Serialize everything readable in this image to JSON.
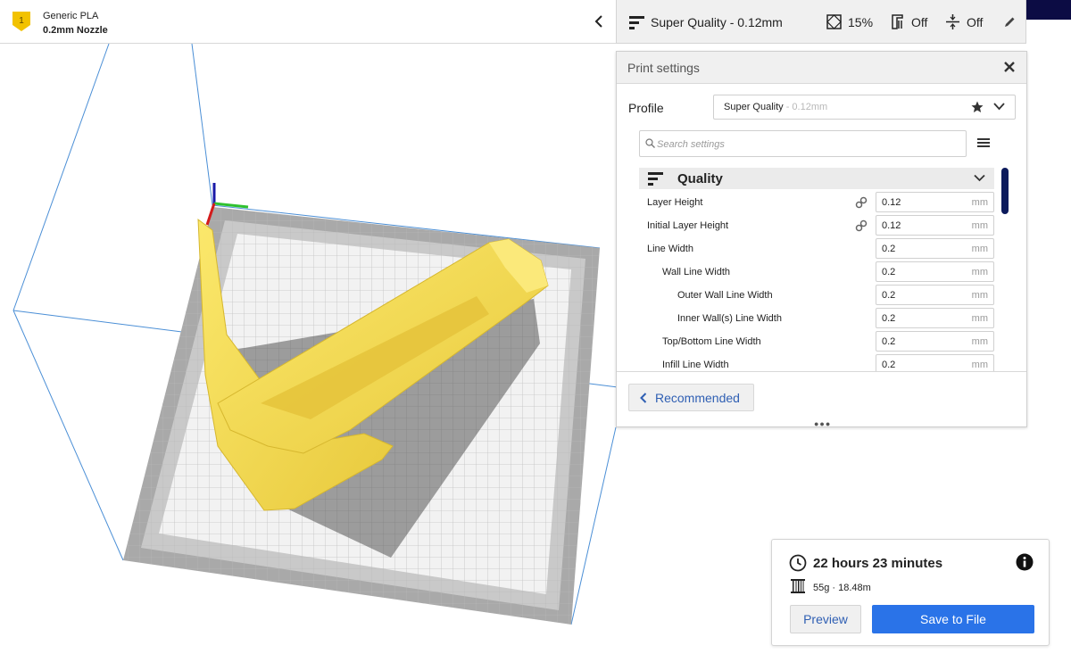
{
  "extruder": {
    "number": "1",
    "material": "Generic PLA",
    "nozzle": "0.2mm Nozzle"
  },
  "settings_bar": {
    "profile": "Super Quality - 0.12mm",
    "infill": "15%",
    "support": "Off",
    "adhesion": "Off"
  },
  "print_settings": {
    "title": "Print settings",
    "profile_label": "Profile",
    "profile_name": "Super Quality",
    "profile_sub": " - 0.12mm",
    "search_placeholder": "Search settings",
    "category": "Quality",
    "rows": [
      {
        "label": "Layer Height",
        "value": "0.12",
        "unit": "mm",
        "linked": true
      },
      {
        "label": "Initial Layer Height",
        "value": "0.12",
        "unit": "mm",
        "linked": true
      },
      {
        "label": "Line Width",
        "value": "0.2",
        "unit": "mm",
        "linked": false
      },
      {
        "label": "Wall Line Width",
        "value": "0.2",
        "unit": "mm",
        "linked": false
      },
      {
        "label": "Outer Wall Line Width",
        "value": "0.2",
        "unit": "mm",
        "linked": false
      },
      {
        "label": "Inner Wall(s) Line Width",
        "value": "0.2",
        "unit": "mm",
        "linked": false
      },
      {
        "label": "Top/Bottom Line Width",
        "value": "0.2",
        "unit": "mm",
        "linked": false
      },
      {
        "label": "Infill Line Width",
        "value": "0.2",
        "unit": "mm",
        "linked": false
      }
    ],
    "recommended_label": "Recommended"
  },
  "estimate": {
    "time": "22 hours 23 minutes",
    "material": "55g · 18.48m",
    "preview_label": "Preview",
    "save_label": "Save to File"
  },
  "colors": {
    "accent": "#2a73e8",
    "link": "#2f5fb3",
    "model": "#f7e15a",
    "dark_strip": "#0c0c44"
  },
  "icons": {
    "extruder": "extruder-badge-icon",
    "collapse": "chevron-left-icon",
    "profile": "quality-layers-icon",
    "infill": "infill-icon",
    "support": "support-icon",
    "adhesion": "adhesion-icon",
    "edit": "pencil-icon",
    "close": "close-icon",
    "favorite": "star-icon",
    "search": "search-icon",
    "menu": "menu-icon",
    "link": "link-icon",
    "clock": "clock-icon",
    "info": "info-icon",
    "spool": "spool-icon"
  }
}
